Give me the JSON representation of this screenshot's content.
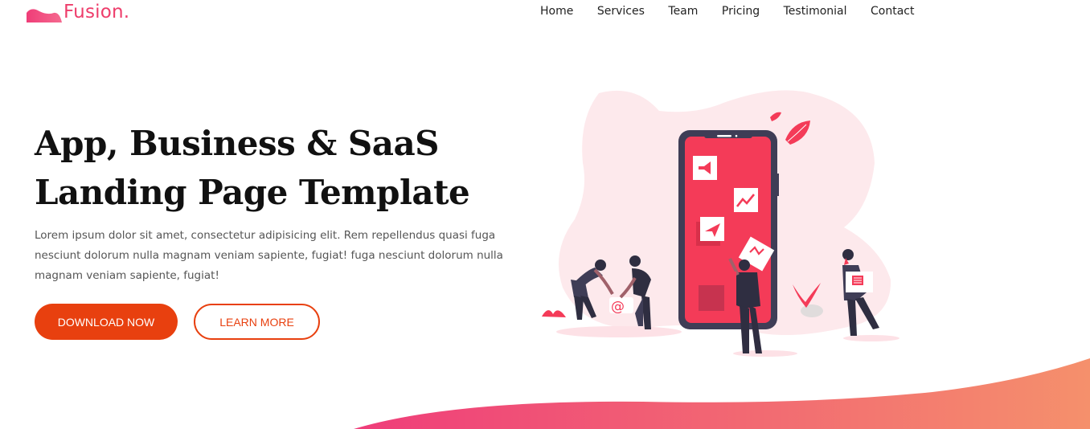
{
  "brand": {
    "name": "Fusion.",
    "logo_icon": "pink-wave-logo"
  },
  "nav": {
    "items": [
      {
        "label": "Home"
      },
      {
        "label": "Services"
      },
      {
        "label": "Team"
      },
      {
        "label": "Pricing"
      },
      {
        "label": "Testimonial"
      },
      {
        "label": "Contact"
      }
    ]
  },
  "hero": {
    "title_line1": "App, Business & SaaS",
    "title_line2": "Landing Page Template",
    "description": "Lorem ipsum dolor sit amet, consectetur adipisicing elit. Rem repellendus quasi fuga nesciunt dolorum nulla magnam veniam sapiente, fugiat! fuga nesciunt dolorum nulla magnam veniam sapiente, fugiat!",
    "primary_button": "DOWNLOAD NOW",
    "secondary_button": "LEARN MORE"
  },
  "colors": {
    "accent": "#e8400f",
    "brand_pink": "#ee3d6b",
    "phone_screen": "#f43b58",
    "phone_frame": "#3f3d56",
    "blob": "#fde9ec"
  }
}
